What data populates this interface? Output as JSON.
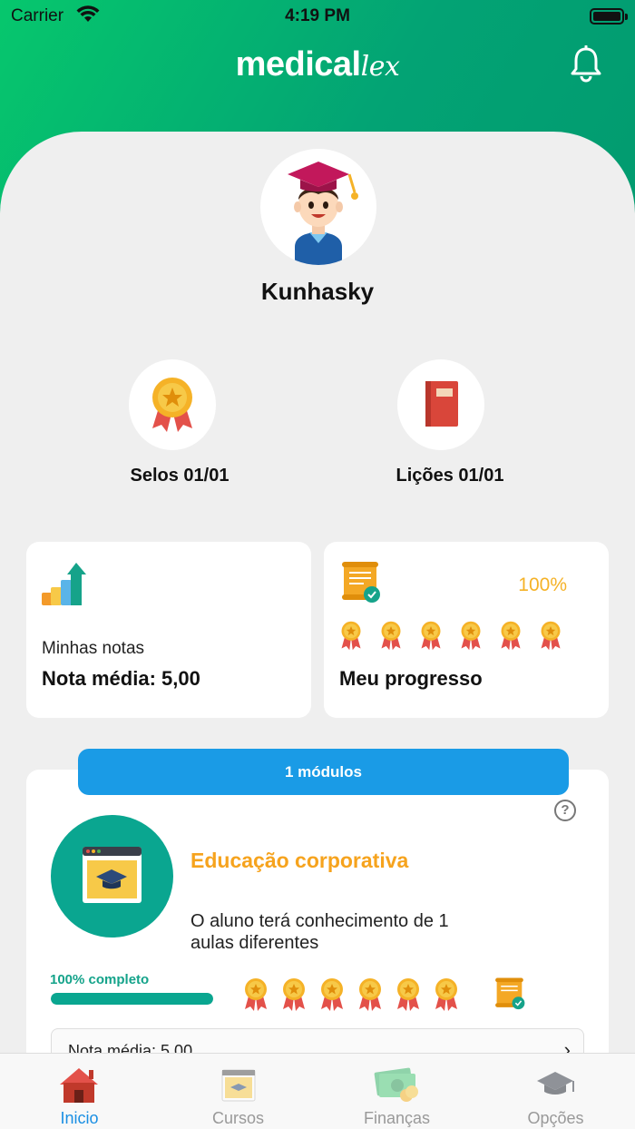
{
  "status_bar": {
    "carrier": "Carrier",
    "time": "4:19 PM"
  },
  "header": {
    "logo_main": "medical",
    "logo_accent": "lex"
  },
  "profile": {
    "name": "Kunhasky"
  },
  "stats": [
    {
      "label": "Selos 01/01",
      "icon": "medal-icon"
    },
    {
      "label": "Lições 01/01",
      "icon": "book-icon"
    }
  ],
  "notes_card": {
    "subtitle": "Minhas notas",
    "average": "Nota média: 5,00"
  },
  "progress_card": {
    "percent": "100%",
    "title": "Meu progresso",
    "medals": 6
  },
  "modules": {
    "pill_label": "1 módulos",
    "course_title": "Educação corporativa",
    "course_description": "O aluno terá conhecimento de 1 aulas diferentes",
    "complete_label": "100% completo",
    "progress": 1.0,
    "medals": 6,
    "avg_row_text": "Nota média: 5,00"
  },
  "tabs": [
    {
      "label": "Inicio",
      "icon": "home-icon",
      "active": true
    },
    {
      "label": "Cursos",
      "icon": "courses-icon",
      "active": false
    },
    {
      "label": "Finanças",
      "icon": "finance-icon",
      "active": false
    },
    {
      "label": "Opções",
      "icon": "graduation-cap-icon",
      "active": false
    }
  ],
  "colors": {
    "brand_green": "#03a374",
    "accent_orange": "#f6a31d",
    "accent_blue": "#1a9be6",
    "teal": "#0aa690"
  }
}
